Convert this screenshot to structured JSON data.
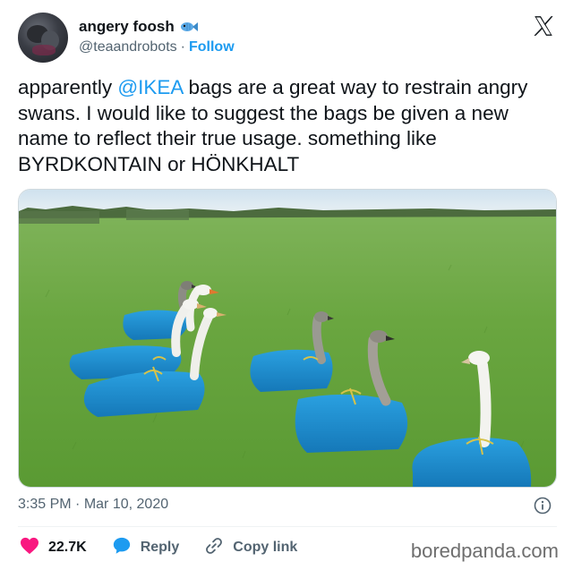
{
  "user": {
    "display_name": "angery foosh",
    "handle": "@teaandrobots",
    "separator": "·",
    "follow_label": "Follow",
    "avatar_icon": "dark-avatar-photo",
    "name_emoji_icon": "fish-icon"
  },
  "brand_icon": "x-logo-icon",
  "tweet": {
    "text_before_mention": "apparently ",
    "mention": "@IKEA",
    "text_after_mention": " bags are a great way to restrain angry swans. I would like to suggest the bags be given a new name to reflect their true usage. something like BYRDKONTAIN or HÖNKHALT"
  },
  "meta": {
    "time": "3:35 PM",
    "separator": "·",
    "date": "Mar 10, 2020",
    "info_icon": "info-icon"
  },
  "actions": {
    "like_icon": "heart-icon",
    "like_count": "22.7K",
    "reply_icon": "reply-bubble-icon",
    "reply_label": "Reply",
    "copy_icon": "link-icon",
    "copy_label": "Copy link"
  },
  "watermark": "boredpanda.com",
  "colors": {
    "accent": "#1d9bf0",
    "heart": "#f91880",
    "muted": "#536471",
    "ikea_blue": "#1f8fd0"
  }
}
